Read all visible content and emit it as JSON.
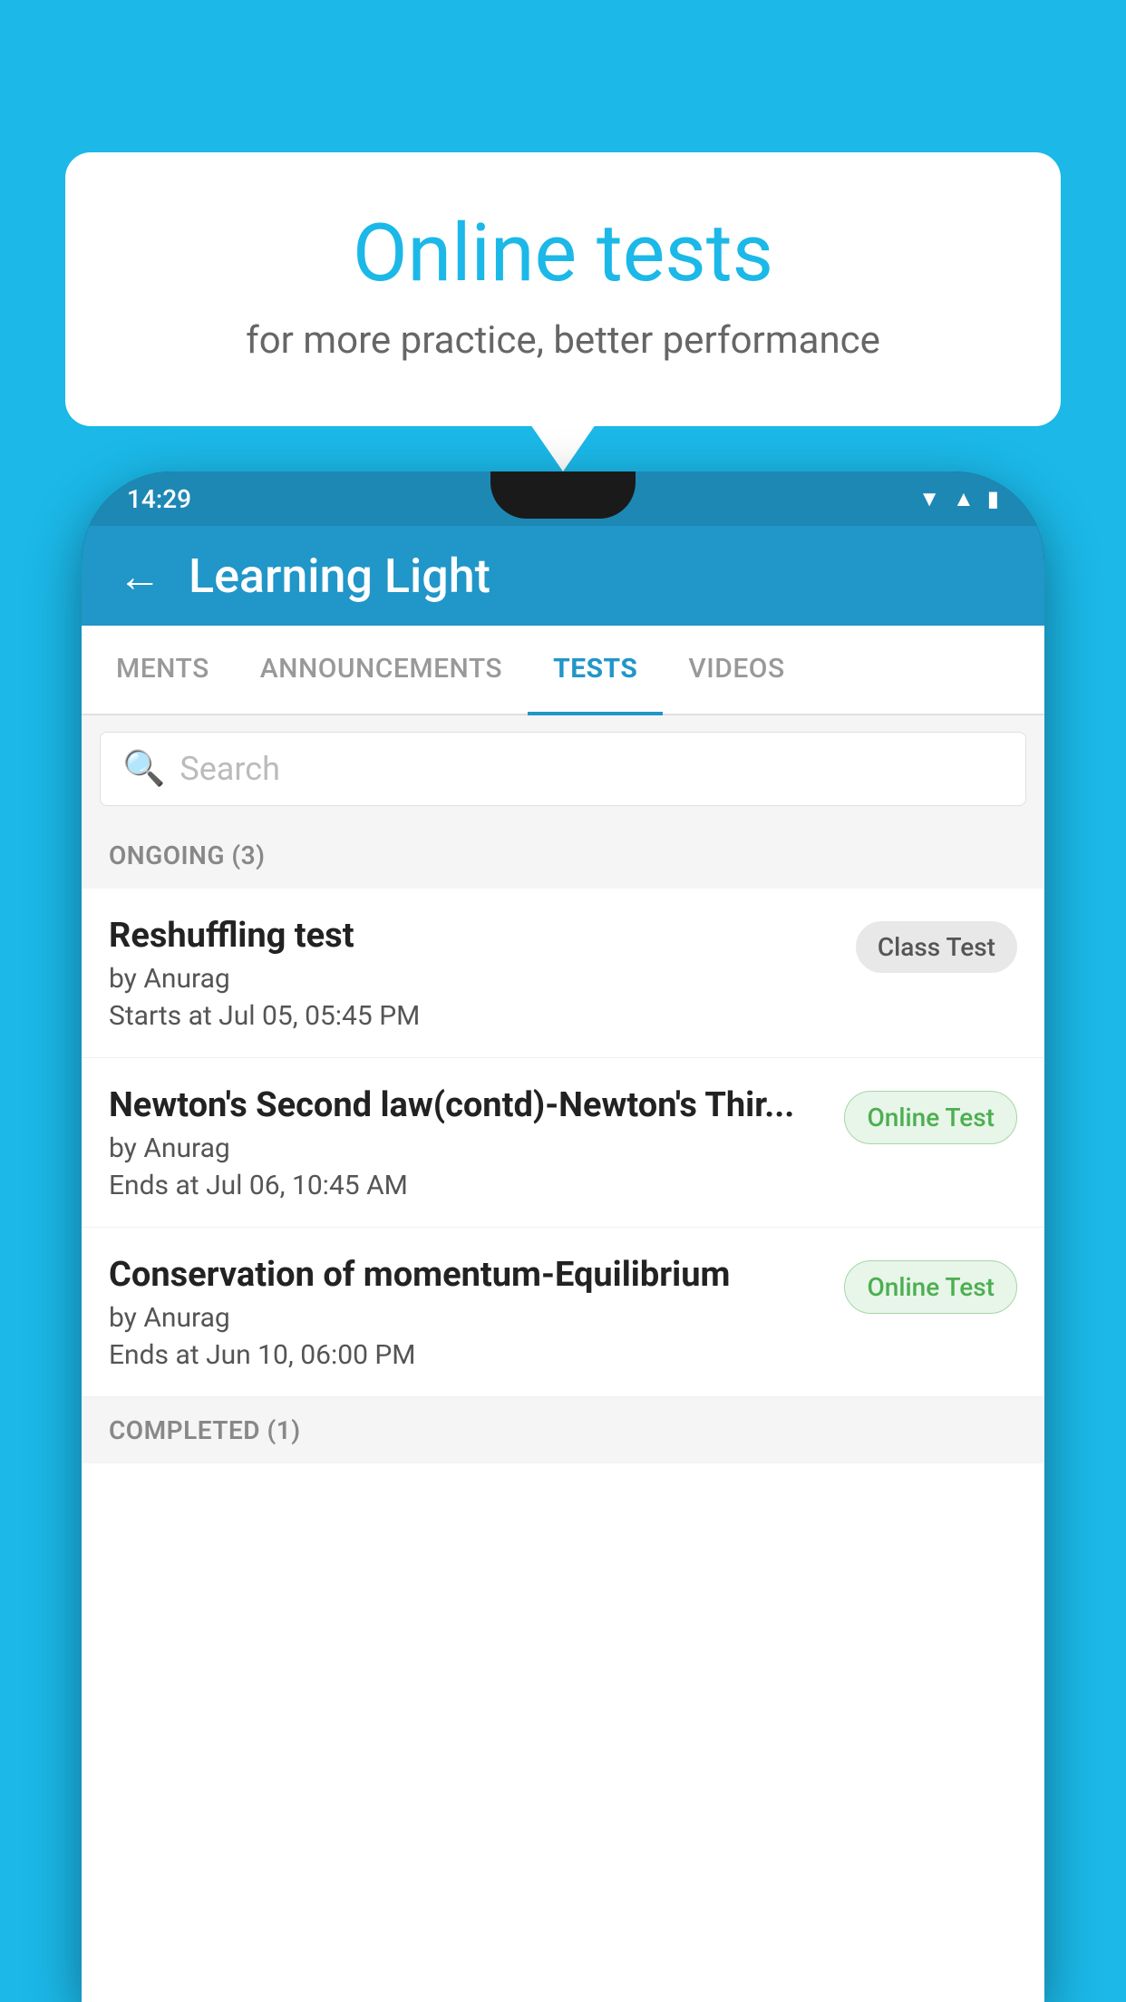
{
  "background_color": "#1BB8E8",
  "speech_bubble": {
    "title": "Online tests",
    "subtitle": "for more practice, better performance"
  },
  "phone": {
    "status_bar": {
      "time": "14:29",
      "icons": [
        "wifi",
        "signal",
        "battery"
      ]
    },
    "app_bar": {
      "back_label": "←",
      "title": "Learning Light"
    },
    "tabs": [
      {
        "label": "MENTS",
        "active": false
      },
      {
        "label": "ANNOUNCEMENTS",
        "active": false
      },
      {
        "label": "TESTS",
        "active": true
      },
      {
        "label": "VIDEOS",
        "active": false
      }
    ],
    "search": {
      "placeholder": "Search"
    },
    "ongoing_section": {
      "label": "ONGOING (3)"
    },
    "test_items": [
      {
        "title": "Reshuffling test",
        "author": "by Anurag",
        "time_label": "Starts at",
        "time": "Jul 05, 05:45 PM",
        "badge": "Class Test",
        "badge_type": "class"
      },
      {
        "title": "Newton's Second law(contd)-Newton's Thir...",
        "author": "by Anurag",
        "time_label": "Ends at",
        "time": "Jul 06, 10:45 AM",
        "badge": "Online Test",
        "badge_type": "online"
      },
      {
        "title": "Conservation of momentum-Equilibrium",
        "author": "by Anurag",
        "time_label": "Ends at",
        "time": "Jun 10, 06:00 PM",
        "badge": "Online Test",
        "badge_type": "online"
      }
    ],
    "completed_section": {
      "label": "COMPLETED (1)"
    }
  }
}
